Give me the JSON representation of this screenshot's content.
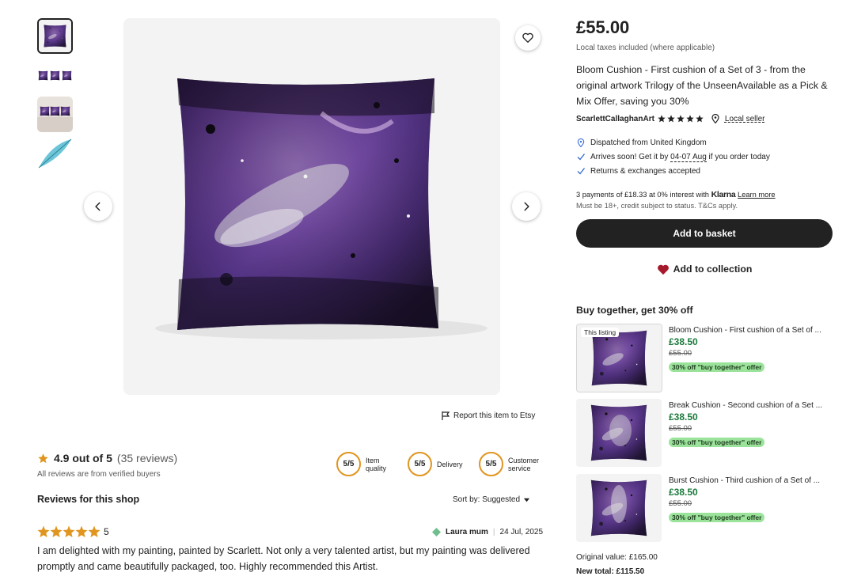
{
  "gallery": {
    "thumbnails": [
      {
        "icon": "cushion-thumbnail",
        "active": true
      },
      {
        "icon": "three-cushions-thumbnail",
        "active": false
      },
      {
        "icon": "sofa-cushions-thumbnail",
        "active": false
      },
      {
        "icon": "feather-thumbnail",
        "active": false
      }
    ],
    "favorite_icon": "heart-outline-icon",
    "prev_icon": "chevron-left-icon",
    "next_icon": "chevron-right-icon"
  },
  "report": {
    "label": "Report this item to Etsy",
    "icon": "flag-icon"
  },
  "reviews": {
    "rating": "4.9 out of 5",
    "count": "(35 reviews)",
    "verified": "All reviews are from verified buyers",
    "badges": [
      {
        "score": "5/5",
        "label_line1": "Item",
        "label_line2": "quality"
      },
      {
        "score": "5/5",
        "label_line1": "Delivery",
        "label_line2": ""
      },
      {
        "score": "5/5",
        "label_line1": "Customer",
        "label_line2": "service"
      }
    ],
    "section_title": "Reviews for this shop",
    "sort_label": "Sort by: Suggested",
    "review": {
      "stars": 5,
      "score": "5",
      "reviewer": "Laura mum",
      "date": "24 Jul, 2025",
      "text": "I am delighted with my painting, painted by Scarlett. Not only a very talented artist, but my painting was delivered promptly and came beautifully packaged, too. Highly recommended this Artist."
    }
  },
  "product": {
    "price": "£55.00",
    "tax_note": "Local taxes included (where applicable)",
    "title": "Bloom Cushion - First cushion of a Set of 3 - from the original artwork Trilogy of the UnseenAvailable as a Pick & Mix Offer, saving you 30%",
    "shop_name": "ScarlettCallaghanArt",
    "shop_rating_stars": 5,
    "local_seller": "Local seller",
    "facts": {
      "dispatch": "Dispatched from United Kingdom",
      "arrives_prefix": "Arrives soon! Get it by",
      "arrives_date": "04-07 Aug",
      "arrives_suffix": "if you order today",
      "returns": "Returns & exchanges accepted"
    },
    "klarna": {
      "text": "3 payments of £18.33 at 0% interest with",
      "brand": "Klarna",
      "learn_more": "Learn more",
      "note": "Must be 18+, credit subject to status. T&Cs apply."
    },
    "basket_label": "Add to basket",
    "collection_label": "Add to collection"
  },
  "bundle": {
    "title": "Buy together, get 30% off",
    "this_listing_tag": "This listing",
    "items": [
      {
        "name": "Bloom Cushion - First cushion of a Set of ...",
        "sale": "£38.50",
        "orig": "£55.00",
        "offer": "30% off \"buy together\" offer"
      },
      {
        "name": "Break Cushion - Second cushion of a Set ...",
        "sale": "£38.50",
        "orig": "£55.00",
        "offer": "30% off \"buy together\" offer"
      },
      {
        "name": "Burst Cushion - Third cushion of a Set of ...",
        "sale": "£38.50",
        "orig": "£55.00",
        "offer": "30% off \"buy together\" offer"
      }
    ],
    "original_value": "Original value: £165.00",
    "new_total": "New total: £115.50"
  },
  "colors": {
    "star": "#e0951f",
    "ring": "#e0951f",
    "sale_green": "#1a7a3b",
    "offer_bg": "#9be39b",
    "button": "#222222",
    "heart": "#a61a2e",
    "check": "#3b6fd6"
  }
}
